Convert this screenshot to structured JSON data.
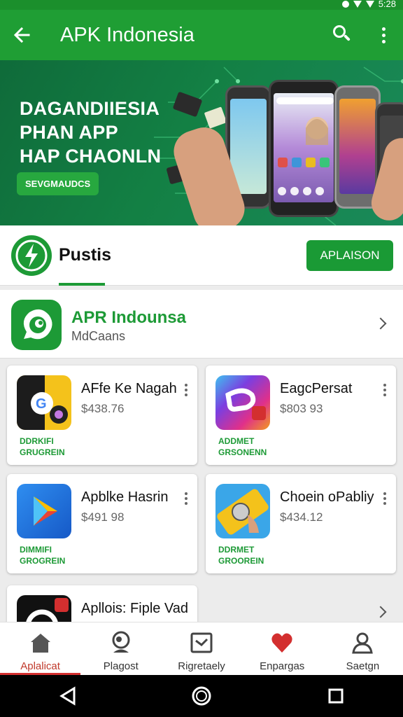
{
  "status": {
    "time": "5:28"
  },
  "appbar": {
    "title": "APK Indonesia"
  },
  "banner": {
    "headline": [
      "DAGANDIIESIA",
      "PHAN APP",
      "HAP CHAONLN"
    ],
    "cta": "SEVGMAUDCS"
  },
  "featured": {
    "label": "Pustis",
    "button": "APLAISON"
  },
  "app_header": {
    "name": "APR Indounsa",
    "sub": "MdCaans"
  },
  "cards": [
    {
      "title": "AFfe Ke Nagah",
      "price": "$438.76",
      "tag": [
        "DDRKIFI",
        "GRUGREIN"
      ]
    },
    {
      "title": "EagcPersat",
      "price": "$803 93",
      "tag": [
        "ADDMET",
        "GRSONENN"
      ]
    },
    {
      "title": "Apblke Hasrin",
      "price": "$491 98",
      "tag": [
        "DIMMIFI",
        "GROGREIN"
      ]
    },
    {
      "title": "Choein oPabliy",
      "price": "$434.12",
      "tag": [
        "DDRMET",
        "GROOREIN"
      ]
    }
  ],
  "partial_card": {
    "title": "Apllois: Fiple Vad"
  },
  "bottom_nav": [
    {
      "label": "Aplalicat",
      "icon": "home-icon"
    },
    {
      "label": "Plagost",
      "icon": "account-icon"
    },
    {
      "label": "Rigretaely",
      "icon": "inbox-icon"
    },
    {
      "label": "Enpargas",
      "icon": "heart-icon"
    },
    {
      "label": "Saetgn",
      "icon": "profile-icon"
    }
  ],
  "colors": {
    "primary": "#1f9e34",
    "accent_red": "#d32f2f"
  }
}
